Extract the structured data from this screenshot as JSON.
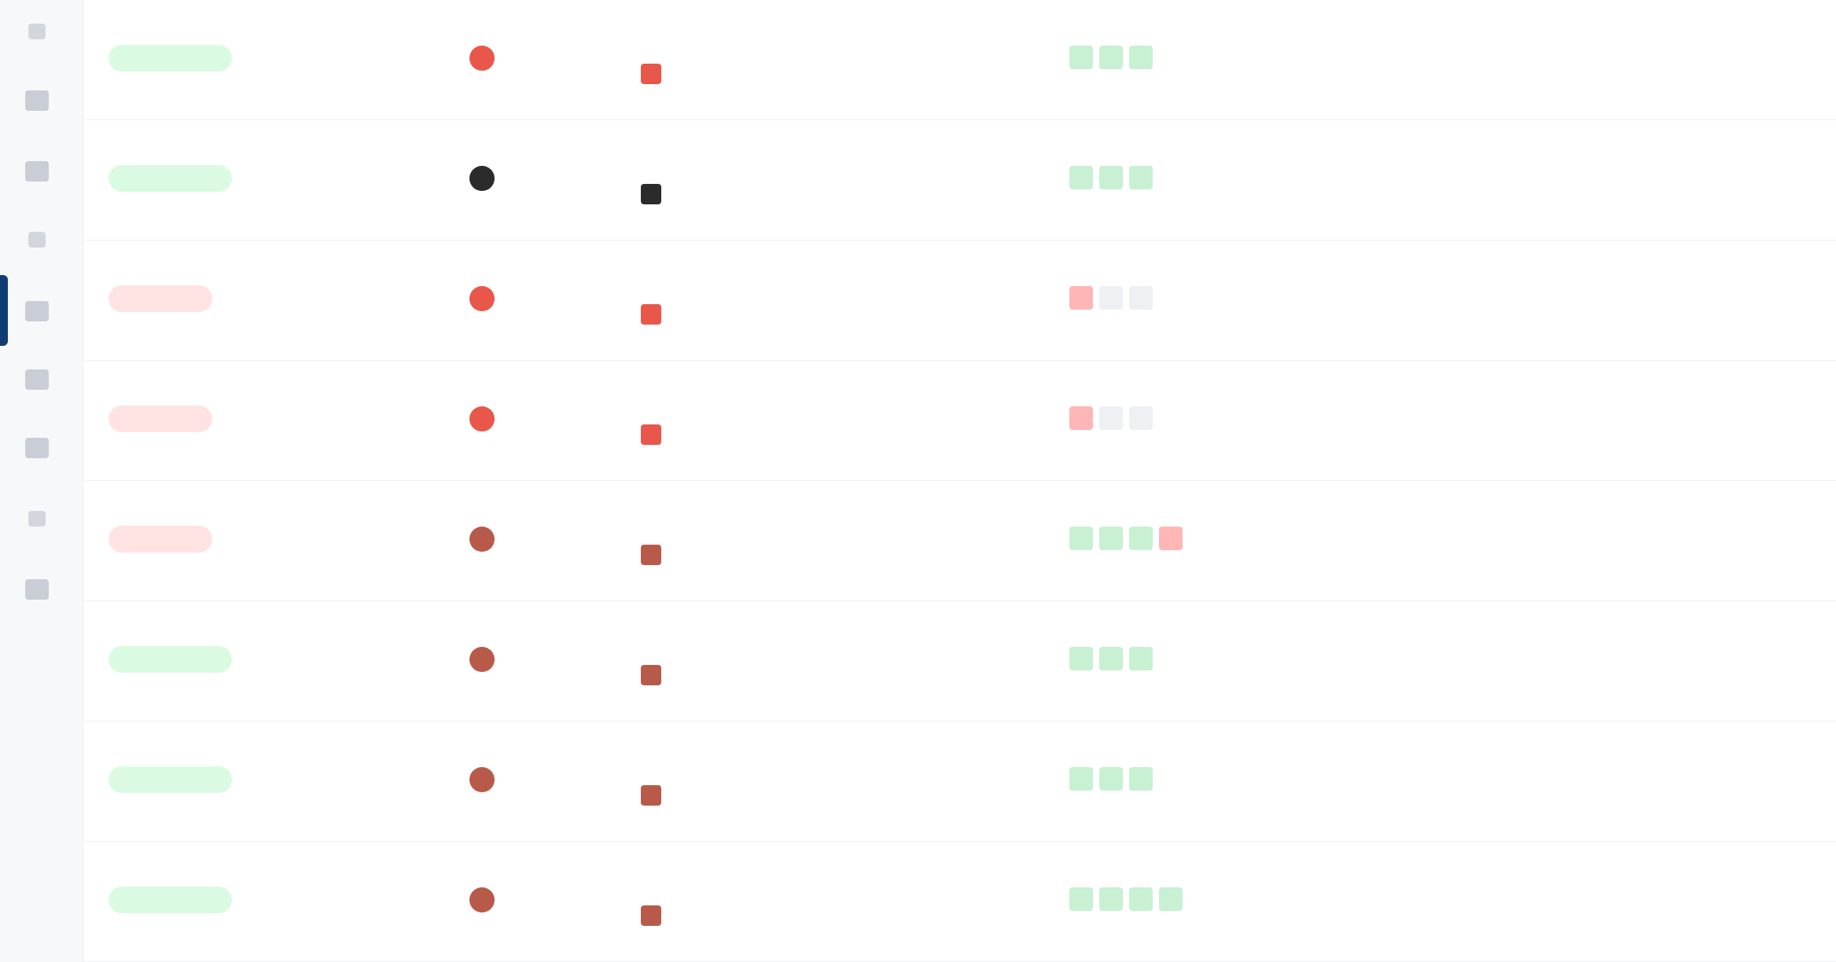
{
  "sidebar": {
    "icons": [
      "nav-icon-1",
      "nav-icon-2",
      "nav-icon-3",
      "nav-icon-4",
      "nav-icon-5",
      "nav-icon-6",
      "nav-icon-7",
      "nav-icon-8",
      "nav-icon-9"
    ]
  },
  "colors": {
    "success": "#1a7f37",
    "failure": "#cf222e",
    "link": "#0969da",
    "sidebar_active": "#0f3d73"
  },
  "rows": [
    {
      "status": "success",
      "status_label": "",
      "commit": "",
      "avatar_color": "#e8574a",
      "title": "",
      "link": "",
      "message": "",
      "checks": [
        "pass",
        "pass",
        "pass"
      ],
      "id": "",
      "time": ""
    },
    {
      "status": "success",
      "status_label": "",
      "commit": "",
      "avatar_color": "#2b2b2b",
      "title": "",
      "link": "",
      "message": "",
      "checks": [
        "pass",
        "pass",
        "pass"
      ],
      "id": "",
      "time": ""
    },
    {
      "status": "failure",
      "status_label": "",
      "commit": "",
      "avatar_color": "#e8574a",
      "title": "",
      "link": "",
      "message": "",
      "checks": [
        "fail",
        "skip",
        "skip"
      ],
      "id": "",
      "time": ""
    },
    {
      "status": "failure",
      "status_label": "",
      "commit": "",
      "avatar_color": "#e8574a",
      "title": "",
      "link": "",
      "message": "",
      "checks": [
        "fail",
        "skip",
        "skip"
      ],
      "id": "",
      "time": ""
    },
    {
      "status": "failure",
      "status_label": "",
      "commit": "",
      "avatar_color": "#b85a4a",
      "title": "",
      "link": "",
      "message": "",
      "checks": [
        "pass",
        "pass",
        "pass",
        "fail"
      ],
      "id": "",
      "time": ""
    },
    {
      "status": "success",
      "status_label": "",
      "commit": "",
      "avatar_color": "#b85a4a",
      "title": "",
      "link": "",
      "message": "",
      "checks": [
        "pass",
        "pass",
        "pass"
      ],
      "id": "",
      "time": ""
    },
    {
      "status": "success",
      "status_label": "",
      "commit": "",
      "avatar_color": "#b85a4a",
      "title": "",
      "link": "",
      "message": "",
      "checks": [
        "pass",
        "pass",
        "pass"
      ],
      "id": "",
      "time": ""
    },
    {
      "status": "success",
      "status_label": "",
      "commit": "",
      "avatar_color": "#b85a4a",
      "title": "",
      "link": "",
      "message": "",
      "checks": [
        "pass",
        "pass",
        "pass",
        "pass"
      ],
      "id": "",
      "time": ""
    }
  ]
}
